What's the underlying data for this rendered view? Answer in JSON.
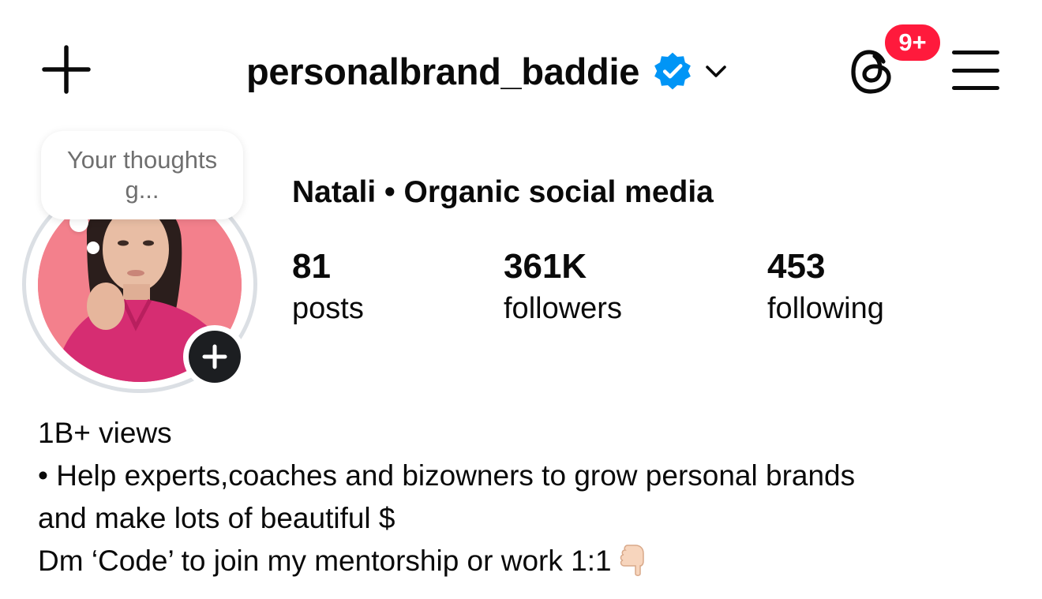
{
  "header": {
    "username": "personalbrand_baddie",
    "verified": true,
    "threads_badge": "9+",
    "badge_color": "#ff1a3c",
    "verified_color": "#0095f6",
    "icons": {
      "create": "plus-icon",
      "verified": "verified-badge-icon",
      "switcher": "chevron-down-icon",
      "threads": "threads-icon",
      "menu": "hamburger-menu-icon"
    }
  },
  "note": {
    "text": "Your thoughts g..."
  },
  "profile": {
    "display_name": "Natali • Organic social media",
    "stats": {
      "posts_count": "81",
      "posts_label": "posts",
      "followers_count": "361K",
      "followers_label": "followers",
      "following_count": "453",
      "following_label": "following"
    }
  },
  "bio": {
    "line1": "1B+ views",
    "line2": "• Help experts,coaches and bizowners to grow personal brands",
    "line3": "and make lots of beautiful $",
    "line4": "Dm ‘Code’ to join my mentorship or work 1:1",
    "emoji": "point-down-emoji"
  },
  "avatar": {
    "background": "#f3808c",
    "shirt": "#d62d72"
  }
}
